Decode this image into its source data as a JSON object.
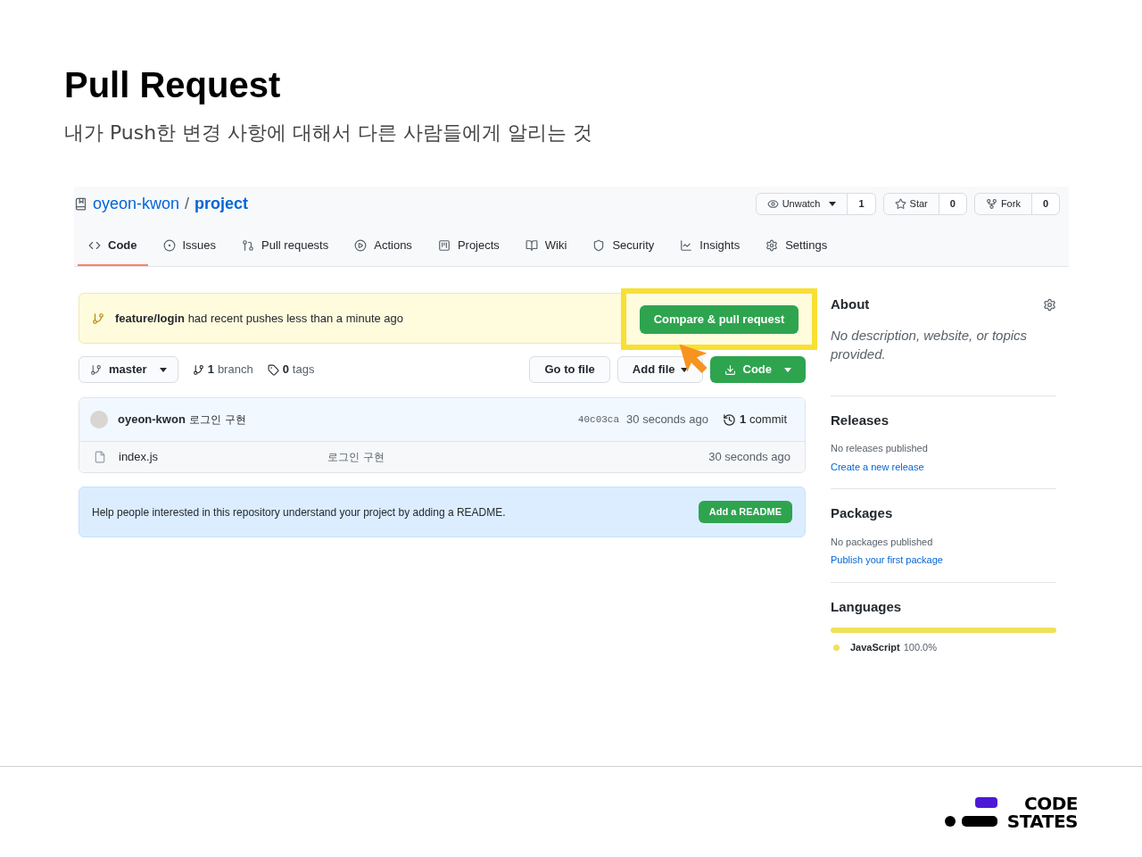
{
  "slide": {
    "title": "Pull Request",
    "subtitle": "내가 Push한 변경 사항에 대해서 다른 사람들에게 알리는 것"
  },
  "repo": {
    "owner": "oyeon-kwon",
    "separator": "/",
    "name": "project"
  },
  "repo_actions": [
    {
      "label": "Unwatch",
      "count": "1",
      "kind": "watch"
    },
    {
      "label": "Star",
      "count": "0",
      "kind": "star"
    },
    {
      "label": "Fork",
      "count": "0",
      "kind": "fork"
    }
  ],
  "tabs": [
    {
      "label": "Code",
      "selected": true
    },
    {
      "label": "Issues",
      "selected": false
    },
    {
      "label": "Pull requests",
      "selected": false
    },
    {
      "label": "Actions",
      "selected": false
    },
    {
      "label": "Projects",
      "selected": false
    },
    {
      "label": "Wiki",
      "selected": false
    },
    {
      "label": "Security",
      "selected": false
    },
    {
      "label": "Insights",
      "selected": false
    },
    {
      "label": "Settings",
      "selected": false
    }
  ],
  "banner": {
    "branch": "feature/login",
    "message": "had recent pushes less than a minute ago",
    "button": "Compare & pull request",
    "highlighted": true
  },
  "branch_bar": {
    "branch": "master",
    "branches_count": "1",
    "branches_label": "branch",
    "tags_count": "0",
    "tags_label": "tags",
    "buttons": [
      {
        "label": "Go to file",
        "kind": "plain"
      },
      {
        "label": "Add file",
        "kind": "menu"
      },
      {
        "label": "Code",
        "kind": "code"
      }
    ]
  },
  "commit": {
    "author": "oyeon-kwon",
    "message": "로그인 구현",
    "sha": "40c03ca",
    "time": "30 seconds ago",
    "commits_count": "1",
    "commits_label": "commit"
  },
  "files": [
    {
      "name": "index.js",
      "message": "로그인 구현",
      "time": "30 seconds ago"
    }
  ],
  "readme": {
    "text": "Help people interested in this repository understand your project by adding a README.",
    "button": "Add a README"
  },
  "sidebar": {
    "about": {
      "title": "About",
      "description": "No description, website, or topics provided."
    },
    "releases": {
      "title": "Releases",
      "text": "No releases published",
      "link": "Create a new release"
    },
    "packages": {
      "title": "Packages",
      "text": "No packages published",
      "link": "Publish your first package"
    },
    "languages": {
      "title": "Languages",
      "items": [
        {
          "name": "JavaScript",
          "percent": "100.0%",
          "color": "#f1e05a",
          "level": 1
        }
      ]
    }
  },
  "logo": {
    "line1": "CODE",
    "line2": "STATES"
  }
}
